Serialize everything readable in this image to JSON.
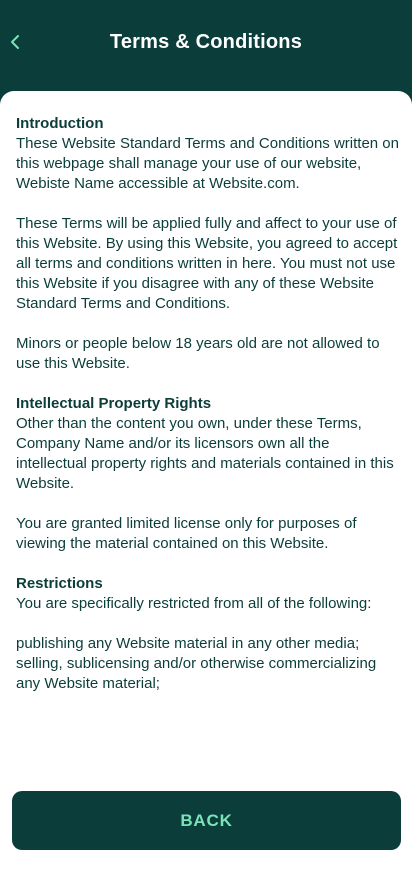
{
  "header": {
    "title": "Terms & Conditions",
    "back_icon": "chevron-left-icon"
  },
  "content": {
    "introduction": {
      "heading": "Introduction",
      "p1": "These Website Standard Terms and Conditions written on this webpage shall manage your use of our website, Webiste Name accessible at Website.com.",
      "p2": "These Terms will be applied fully and affect to your use of this Website. By using this Website, you agreed to accept all terms and conditions written in here. You must not use this Website if you disagree with any of these Website Standard Terms and Conditions.",
      "p3": "Minors or people below 18 years old are not allowed to use this Website."
    },
    "ip_rights": {
      "heading": "Intellectual Property Rights",
      "p1": "Other than the content you own, under these Terms, Company Name and/or its licensors own all the intellectual property rights and materials contained in this Website.",
      "p2": "You are granted limited license only for purposes of viewing the material contained on this Website."
    },
    "restrictions": {
      "heading": "Restrictions",
      "p1": "You are specifically restricted from all of the following:",
      "item1": "publishing any Website material in any other media;",
      "item2": "selling, sublicensing and/or otherwise commercializing any Website material;"
    }
  },
  "footer": {
    "back_label": "BACK"
  },
  "colors": {
    "brand_dark": "#0b3d3a",
    "accent": "#7be3b8",
    "surface": "#ffffff"
  }
}
